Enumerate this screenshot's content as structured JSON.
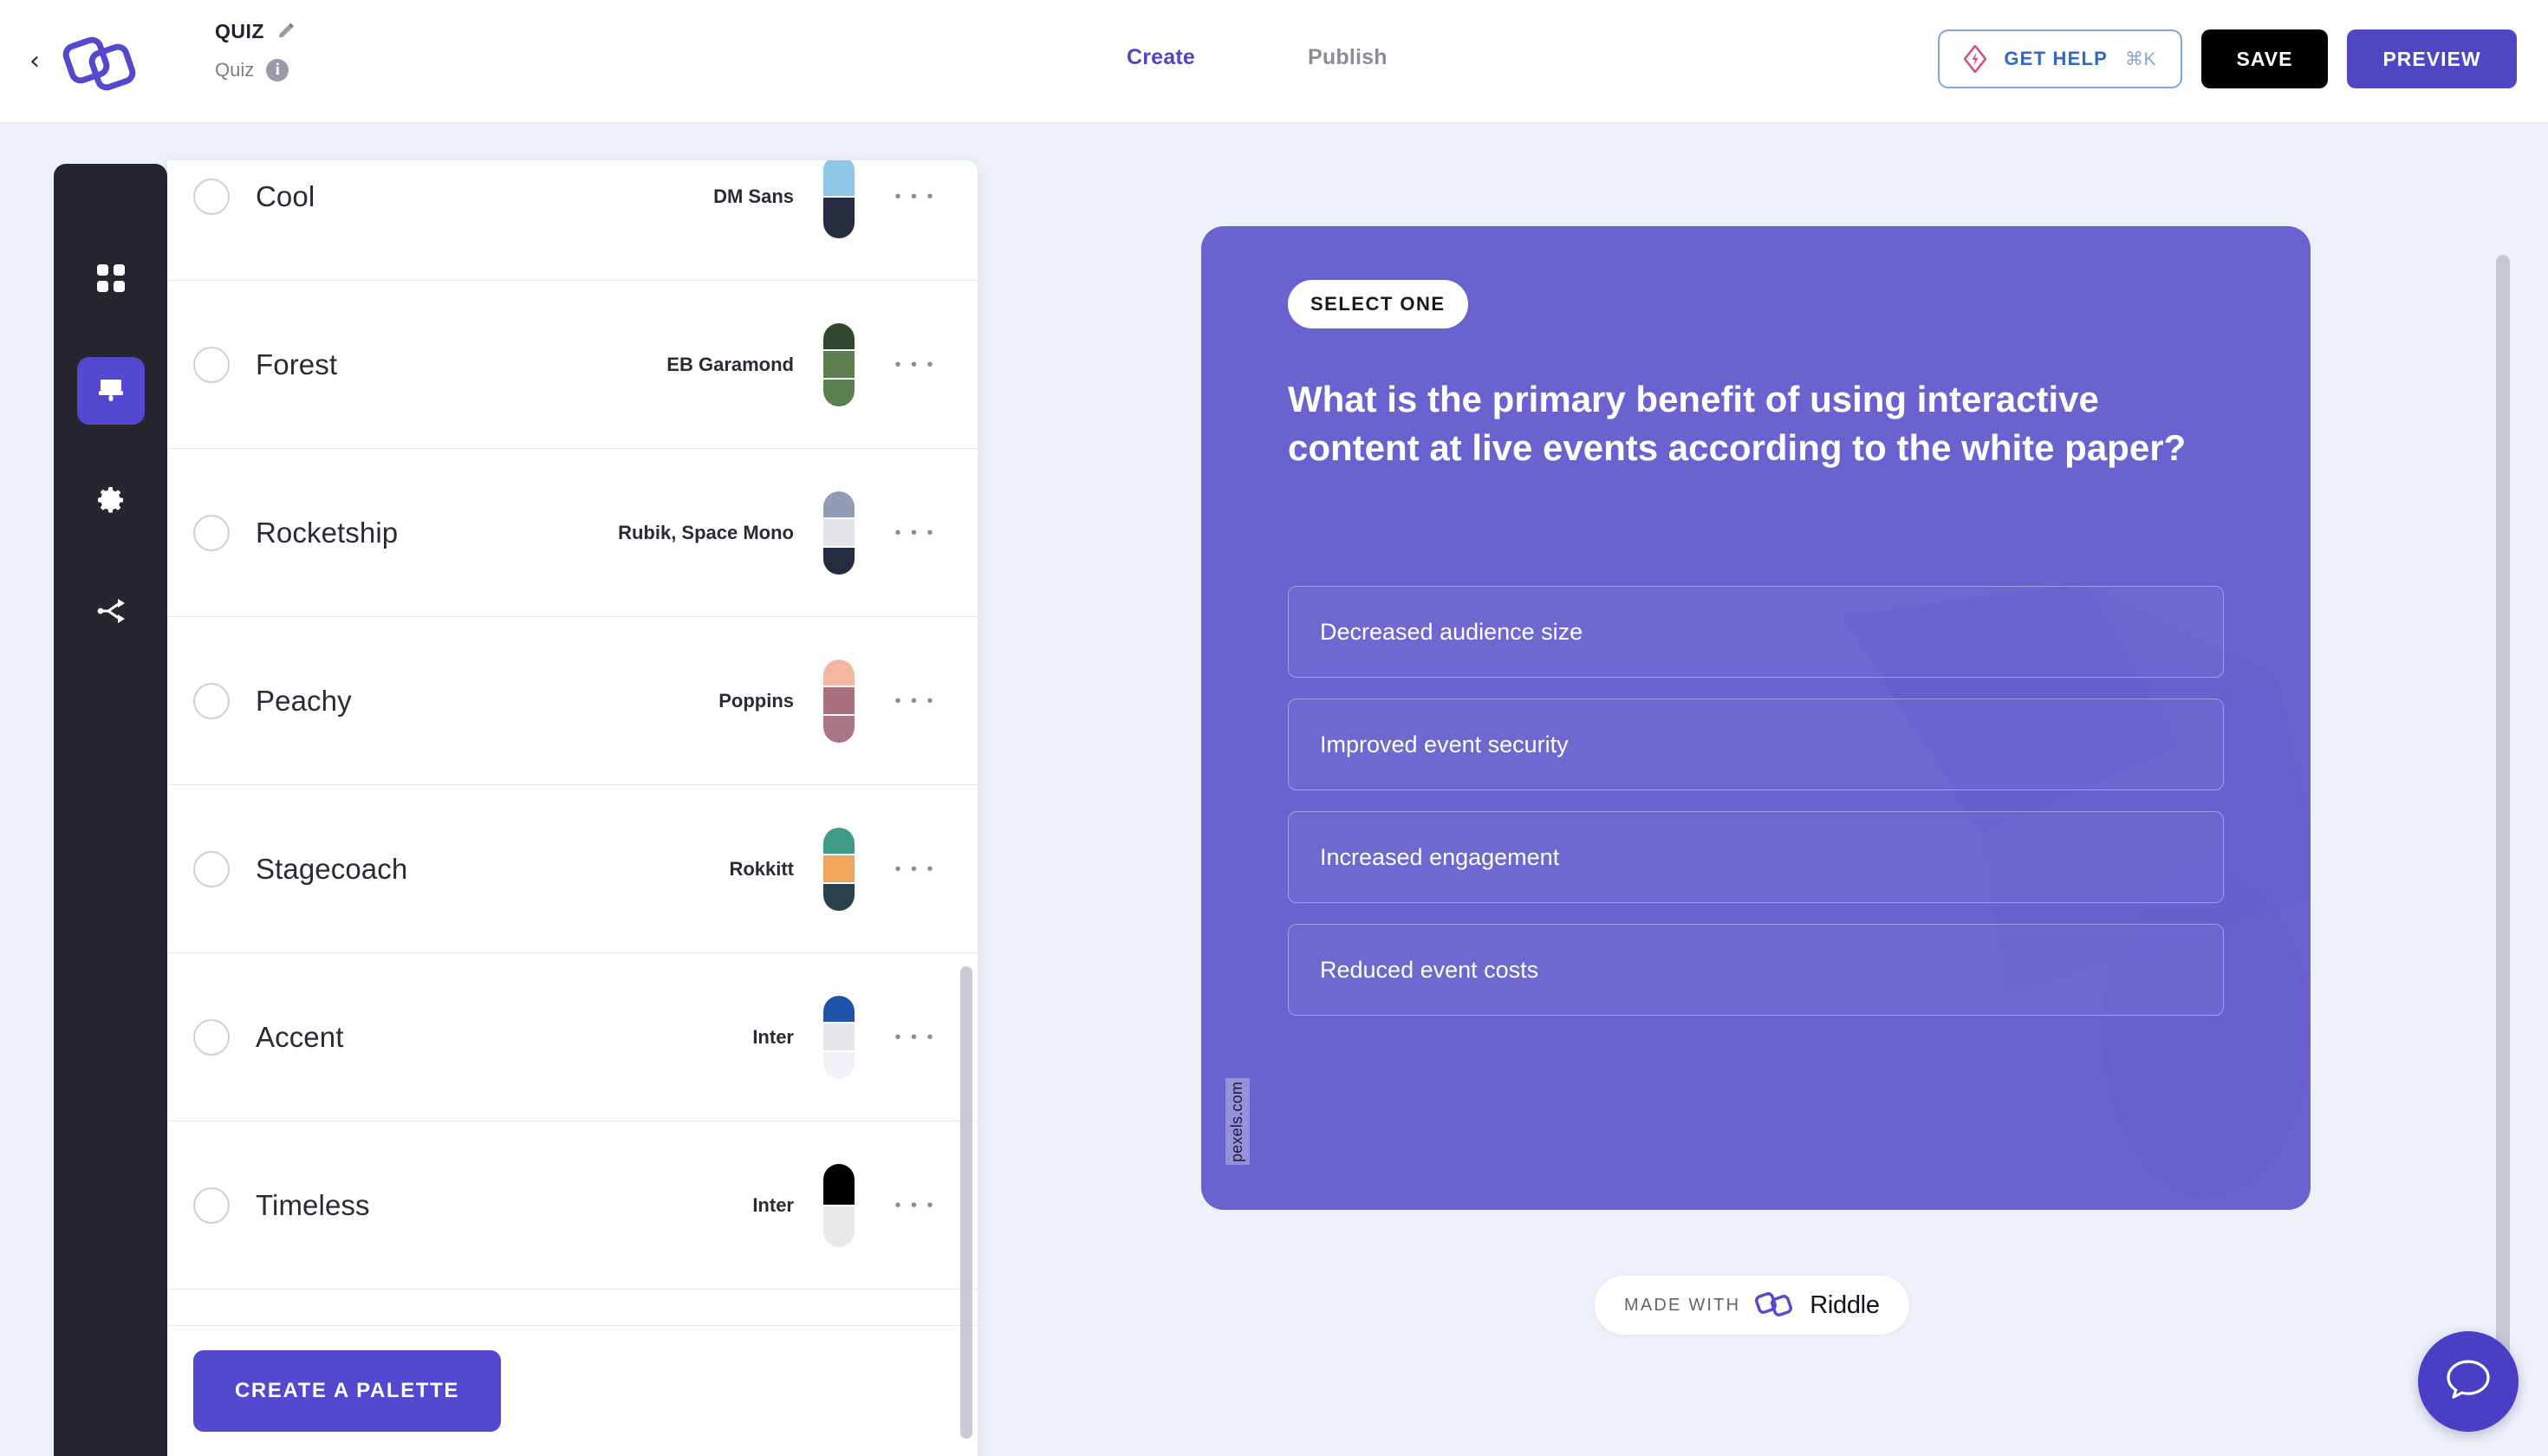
{
  "header": {
    "back_icon": "chevron-left-icon",
    "logo": "riddle-logo",
    "title": "QUIZ",
    "edit_icon": "pencil-icon",
    "subtitle": "Quiz",
    "info_icon": "info-icon",
    "tabs": [
      {
        "label": "Create",
        "active": true
      },
      {
        "label": "Publish",
        "active": false
      }
    ],
    "get_help": {
      "label": "GET HELP",
      "shortcut": "⌘K",
      "icon": "help-diamond-icon"
    },
    "save_label": "SAVE",
    "preview_label": "PREVIEW",
    "colors": {
      "accent": "#4f46c4",
      "help_border": "#7ba7de",
      "help_text": "#2f68c5"
    }
  },
  "rail": {
    "items": [
      {
        "name": "blocks-grid-icon",
        "label": "Blocks",
        "active": false
      },
      {
        "name": "paintbrush-icon",
        "label": "Design",
        "active": true
      },
      {
        "name": "gear-icon",
        "label": "Settings",
        "active": false
      },
      {
        "name": "share-nodes-icon",
        "label": "Share",
        "active": false
      }
    ],
    "active_bg": "#5348ce",
    "bg": "#26262f"
  },
  "palette_panel": {
    "rows": [
      {
        "name": "Cool",
        "font": "DM Sans",
        "selected": false,
        "colors": [
          "#8ec6e8",
          "#262b3f"
        ],
        "menu_icon": "ellipsis-icon"
      },
      {
        "name": "Forest",
        "font": "EB Garamond",
        "selected": false,
        "colors": [
          "#32472f",
          "#5e8050",
          "#5a8052"
        ],
        "menu_icon": "ellipsis-icon"
      },
      {
        "name": "Rocketship",
        "font": "Rubik, Space Mono",
        "selected": false,
        "colors": [
          "#8f9cb4",
          "#e2e3e7",
          "#262b3f"
        ],
        "menu_icon": "ellipsis-icon"
      },
      {
        "name": "Peachy",
        "font": "Poppins",
        "selected": false,
        "colors": [
          "#f3b6a2",
          "#a9717f",
          "#ab7684"
        ],
        "menu_icon": "ellipsis-icon"
      },
      {
        "name": "Stagecoach",
        "font": "Rokkitt",
        "selected": false,
        "colors": [
          "#3f9a86",
          "#eda65c",
          "#2a404a"
        ],
        "menu_icon": "ellipsis-icon"
      },
      {
        "name": "Accent",
        "font": "Inter",
        "selected": false,
        "colors": [
          "#1f55ad",
          "#e6e7ea",
          "#f1f2f5"
        ],
        "menu_icon": "ellipsis-icon"
      },
      {
        "name": "Timeless",
        "font": "Inter",
        "selected": false,
        "colors": [
          "#000000",
          "#e9e9eb"
        ],
        "menu_icon": "ellipsis-icon"
      }
    ],
    "create_button_label": "CREATE A PALETTE",
    "scrollbar": "palette-scrollbar"
  },
  "preview": {
    "badge": "SELECT ONE",
    "question": "What is the primary benefit of using interactive content at live events according to the white paper?",
    "options": [
      "Decreased audience size",
      "Improved event security",
      "Increased engagement",
      "Reduced event costs"
    ],
    "watermark": "pexels.com",
    "card_bg": "#6a62cf",
    "footer": {
      "prefix": "MADE WITH",
      "brand": "Riddle",
      "logo": "riddle-logo"
    }
  },
  "widgets": {
    "chat_icon": "chat-bubble-icon",
    "chat_bg": "#4a3fc4",
    "page_scrollbar": "page-scrollbar"
  }
}
